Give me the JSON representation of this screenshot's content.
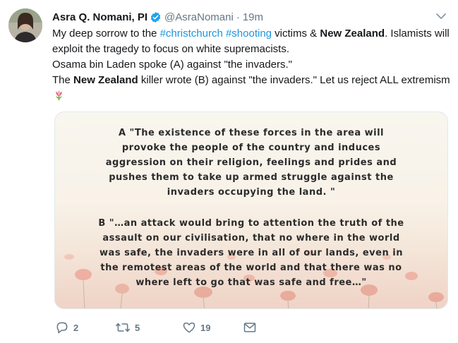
{
  "tweet": {
    "author_name": "Asra Q. Nomani, PI",
    "handle": "@AsraNomani",
    "separator": "·",
    "time": "19m",
    "text": {
      "line1_pre": "My deep sorrow to the ",
      "hashtag1": "#christchurch",
      "space": " ",
      "hashtag2": "#shooting",
      "line1_mid": " victims & ",
      "bold1": "New Zealand",
      "line1_post": ". Islamists will exploit the tragedy to focus on white supremacists.",
      "line2": "Osama bin Laden spoke (A) against \"the invaders.\"",
      "line3_pre": "The ",
      "bold2": "New Zealand",
      "line3_post": " killer wrote (B) against \"the invaders.\" Let us reject ALL extremism"
    },
    "emoji": "tulip-emoji",
    "image": {
      "quote_a_lines": [
        "A  \"The existence of these forces in the area will",
        "provoke the people of the country and induces",
        "aggression on their religion, feelings and prides and",
        "pushes them to take up armed struggle against the",
        "invaders occupying the land. \""
      ],
      "quote_b_lines": [
        "B  \"…an attack would bring to attention the truth of the",
        "assault on our civilisation, that no where in the world",
        "was safe, the invaders were in all of our lands, even in",
        "the remotest areas of the world and that there was no",
        "where left to go that was safe and free…\""
      ]
    },
    "actions": {
      "reply_count": "2",
      "retweet_count": "5",
      "like_count": "19"
    }
  },
  "colors": {
    "link": "#1b95e0",
    "muted": "#657786",
    "text": "#14171a",
    "verified": "#1da1f2"
  }
}
